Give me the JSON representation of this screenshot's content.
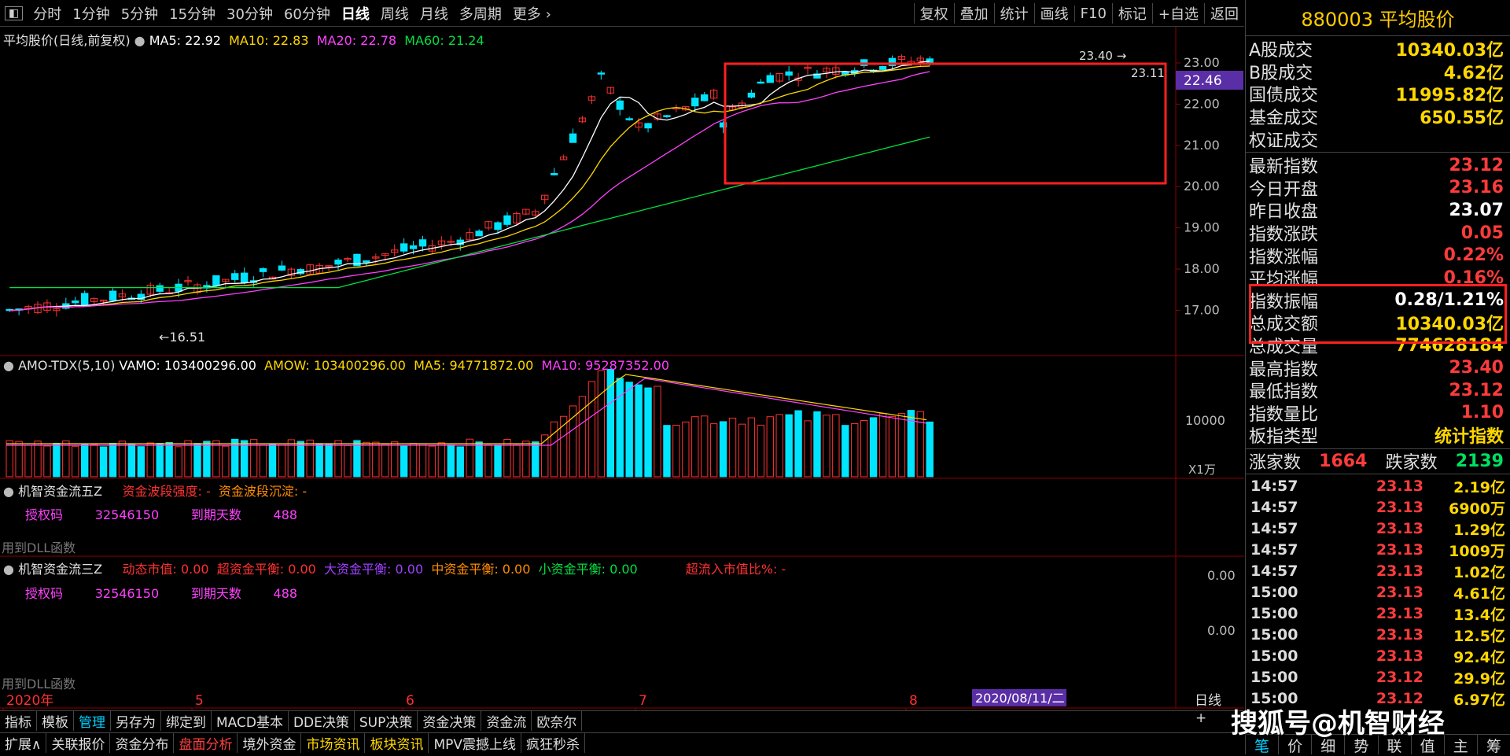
{
  "toolbar": {
    "periods": [
      "分时",
      "1分钟",
      "5分钟",
      "15分钟",
      "30分钟",
      "60分钟",
      "日线",
      "周线",
      "月线",
      "多周期",
      "更多"
    ],
    "active": "日线",
    "right": [
      "复权",
      "叠加",
      "统计",
      "画线",
      "F10",
      "标记",
      "+自选",
      "返回"
    ]
  },
  "main": {
    "title": "平均股价(日线,前复权)",
    "ma5": "MA5: 22.92",
    "ma10": "MA10: 22.83",
    "ma20": "MA20: 22.78",
    "ma60": "MA60: 21.24",
    "high_label": "23.40",
    "current_label": "23.11",
    "price_tag": "22.46",
    "low_label": "16.51",
    "yticks": [
      "23.00",
      "22.00",
      "21.00",
      "20.00",
      "19.00",
      "18.00",
      "17.00"
    ]
  },
  "volume": {
    "title": "AMO-TDX(5,10)",
    "vamo": "VAMO: 103400296.00",
    "amow": "AMOW: 103400296.00",
    "ma5": "MA5: 94771872.00",
    "ma10": "MA10: 95287352.00",
    "ytick": "10000",
    "unit": "X1万"
  },
  "flow5": {
    "title": "机智资金流五Z",
    "s1": "资金波段强度: -",
    "s2": "资金波段沉淀: -",
    "auth_label": "授权码",
    "auth_code": "32546150",
    "days_label": "到期天数",
    "days": "488",
    "dll": "用到DLL函数"
  },
  "flow3": {
    "title": "机智资金流三Z",
    "f1": "动态市值: 0.00",
    "f2": "超资金平衡: 0.00",
    "f3": "大资金平衡: 0.00",
    "f4": "中资金平衡: 0.00",
    "f5": "小资金平衡: 0.00",
    "f6": "超流入市值比%: -",
    "auth_label": "授权码",
    "auth_code": "32546150",
    "days_label": "到期天数",
    "days": "488",
    "dll": "用到DLL函数",
    "yticks": [
      "0.00",
      "0.00"
    ]
  },
  "xaxis": {
    "labels": [
      "2020年",
      "5",
      "6",
      "7",
      "8"
    ],
    "cursor_date": "2020/08/11/二",
    "period": "日线"
  },
  "bottom_tabs1": [
    "指标",
    "模板",
    "管理",
    "另存为",
    "绑定到",
    "MACD基本",
    "DDE决策",
    "SUP决策",
    "资金决策",
    "资金流",
    "欧奈尔"
  ],
  "bottom_tabs2": [
    "扩展∧",
    "关联报价",
    "资金分布",
    "盘面分析",
    "境外资金",
    "市场资讯",
    "板块资讯",
    "MPV震撼上线",
    "疯狂秒杀"
  ],
  "watermark": "搜狐号@机智财经",
  "panel": {
    "code_name": "880003 平均股价",
    "rows1": [
      {
        "label": "A股成交",
        "value": "10340.03亿",
        "color": "yellow"
      },
      {
        "label": "B股成交",
        "value": "4.62亿",
        "color": "yellow"
      },
      {
        "label": "国债成交",
        "value": "11995.82亿",
        "color": "yellow"
      },
      {
        "label": "基金成交",
        "value": "650.55亿",
        "color": "yellow"
      },
      {
        "label": "权证成交",
        "value": "",
        "color": "yellow"
      }
    ],
    "rows2": [
      {
        "label": "最新指数",
        "value": "23.12",
        "color": "red"
      },
      {
        "label": "今日开盘",
        "value": "23.16",
        "color": "red"
      },
      {
        "label": "昨日收盘",
        "value": "23.07",
        "color": "white"
      },
      {
        "label": "指数涨跌",
        "value": "0.05",
        "color": "red"
      },
      {
        "label": "指数涨幅",
        "value": "0.22%",
        "color": "red"
      },
      {
        "label": "平均涨幅",
        "value": "0.16%",
        "color": "red"
      },
      {
        "label": "指数振幅",
        "value": "0.28/1.21%",
        "color": "white"
      },
      {
        "label": "总成交额",
        "value": "10340.03亿",
        "color": "yellow"
      },
      {
        "label": "总成交量",
        "value": "774628184",
        "color": "yellow"
      },
      {
        "label": "最高指数",
        "value": "23.40",
        "color": "red"
      },
      {
        "label": "最低指数",
        "value": "23.12",
        "color": "red"
      },
      {
        "label": "指数量比",
        "value": "1.10",
        "color": "red"
      },
      {
        "label": "板指类型",
        "value": "统计指数",
        "color": "yellow"
      }
    ],
    "up_label": "涨家数",
    "up": "1664",
    "down_label": "跌家数",
    "down": "2139",
    "trades": [
      {
        "t": "14:57",
        "p": "23.13",
        "v": "2.19亿"
      },
      {
        "t": "14:57",
        "p": "23.13",
        "v": "6900万"
      },
      {
        "t": "14:57",
        "p": "23.13",
        "v": "1.29亿"
      },
      {
        "t": "14:57",
        "p": "23.13",
        "v": "1009万"
      },
      {
        "t": "14:57",
        "p": "23.13",
        "v": "1.02亿"
      },
      {
        "t": "15:00",
        "p": "23.13",
        "v": "4.61亿"
      },
      {
        "t": "15:00",
        "p": "23.13",
        "v": "13.4亿"
      },
      {
        "t": "15:00",
        "p": "23.13",
        "v": "12.5亿"
      },
      {
        "t": "15:00",
        "p": "23.13",
        "v": "92.4亿"
      },
      {
        "t": "15:00",
        "p": "23.12",
        "v": "29.9亿"
      },
      {
        "t": "15:00",
        "p": "23.12",
        "v": "6.97亿"
      }
    ],
    "bottom_tabs": [
      "笔",
      "价",
      "细",
      "势",
      "联",
      "值",
      "主",
      "筹"
    ]
  }
}
